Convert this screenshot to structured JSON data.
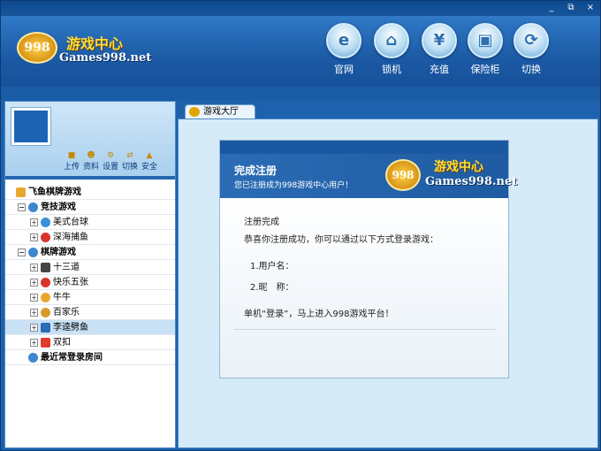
{
  "header": {
    "logo_badge": "998",
    "logo_title": "游戏中心",
    "logo_subtitle": "Games998.net",
    "buttons": [
      {
        "label": "官网",
        "icon": "ie-icon"
      },
      {
        "label": "锁机",
        "icon": "lock-icon"
      },
      {
        "label": "充值",
        "icon": "yen-icon"
      },
      {
        "label": "保险柜",
        "icon": "safe-icon"
      },
      {
        "label": "切换",
        "icon": "refresh-icon"
      }
    ]
  },
  "window_controls": {
    "restore": "⧉",
    "close": "×"
  },
  "user_panel": {
    "actions": [
      {
        "label": "上传",
        "icon": "upload-icon"
      },
      {
        "label": "资料",
        "icon": "profile-icon"
      },
      {
        "label": "设置",
        "icon": "settings-icon"
      },
      {
        "label": "切换",
        "icon": "switch-icon"
      },
      {
        "label": "安全",
        "icon": "shield-icon"
      }
    ]
  },
  "tree": {
    "root": "飞鱼棋牌游戏",
    "group_competitive": "竞技游戏",
    "competitive_items": [
      "美式台球",
      "深海捕鱼"
    ],
    "group_board": "棋牌游戏",
    "board_items": [
      "十三道",
      "快乐五张",
      "牛牛",
      "百家乐",
      "李逵劈鱼",
      "双扣"
    ],
    "recent": "最近常登录房间",
    "selected": "李逵劈鱼"
  },
  "tabs": {
    "lobby": "游戏大厅"
  },
  "card": {
    "title": "完成注册",
    "subtitle": "您已注册成为998游戏中心用户！",
    "logo_badge": "998",
    "logo_title": "游戏中心",
    "logo_subtitle": "Games998.net",
    "line1": "注册完成",
    "line2": "恭喜你注册成功，你可以通过以下方式登录游戏：",
    "line3": "1.用户名：",
    "line4": "2.昵　称：",
    "line5": "单机“登录”，马上进入998游戏平台！"
  }
}
